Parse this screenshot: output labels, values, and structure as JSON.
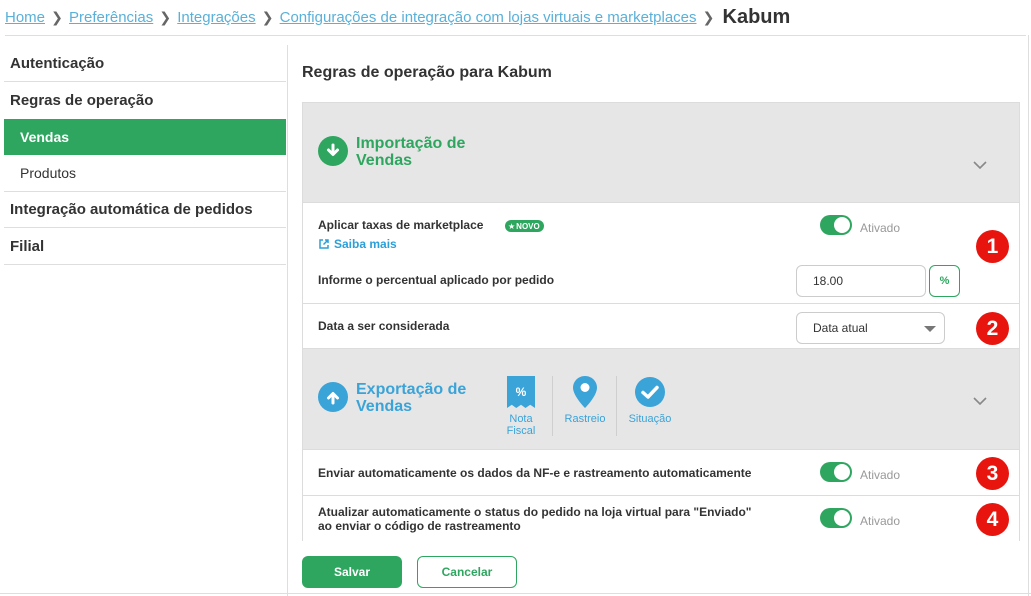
{
  "breadcrumb": {
    "items": [
      "Home",
      "Preferências",
      "Integrações",
      "Configurações de integração com lojas virtuais e marketplaces"
    ],
    "current": "Kabum"
  },
  "sidebar": {
    "items": [
      {
        "label": "Autenticação"
      },
      {
        "label": "Regras de operação"
      },
      {
        "label": "Vendas"
      },
      {
        "label": "Produtos"
      },
      {
        "label": "Integração automática de pedidos"
      },
      {
        "label": "Filial"
      }
    ]
  },
  "main": {
    "title": "Regras de operação para Kabum",
    "import_section": {
      "title_line1": "Importação de",
      "title_line2": "Vendas",
      "marketplace_fees": {
        "label": "Aplicar taxas de marketplace",
        "badge": "NOVO",
        "link": "Saiba mais",
        "status": "Ativado"
      },
      "percent_label": "Informe o percentual aplicado por pedido",
      "percent_value": "18.00",
      "percent_button": "%",
      "date_label": "Data a ser considerada",
      "date_value": "Data atual"
    },
    "export_section": {
      "title_line1": "Exportação de",
      "title_line2": "Vendas",
      "features": {
        "nf_line1": "Nota",
        "nf_line2": "Fiscal",
        "nf_icon_text": "%",
        "tracking": "Rastreio",
        "status": "Situação"
      },
      "auto_send": {
        "label": "Enviar automaticamente os dados da NF-e e rastreamento automaticamente",
        "status": "Ativado"
      },
      "auto_update": {
        "label_line1": "Atualizar automaticamente o status do pedido na loja virtual para \"Enviado\"",
        "label_line2": "ao enviar o código de rastreamento",
        "status": "Ativado"
      }
    },
    "markers": [
      "1",
      "2",
      "3",
      "4"
    ],
    "save_label": "Salvar",
    "cancel_label": "Cancelar"
  },
  "colors": {
    "primary_green": "#2fa660",
    "link_blue": "#5ab0d8",
    "export_blue": "#3aa3d8",
    "marker_red": "#e8140e"
  }
}
